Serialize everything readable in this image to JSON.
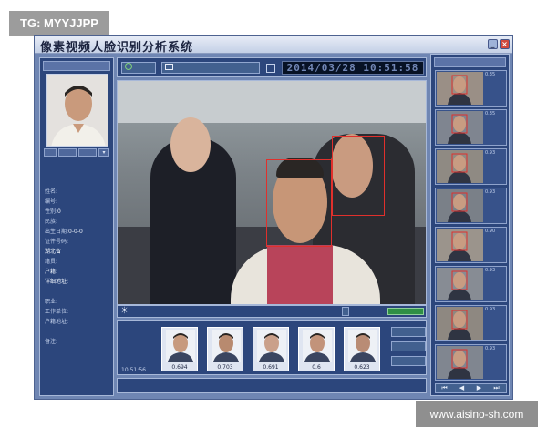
{
  "badges": {
    "top": "TG: MYYJJPP",
    "bottom": "www.aisino-sh.com"
  },
  "window": {
    "title": "像素视频人脸识别分析系统"
  },
  "left_panel": {
    "header": "",
    "buttons": [
      "",
      "",
      ""
    ],
    "fields": [
      {
        "key": "姓名:",
        "value": ""
      },
      {
        "key": "编号:",
        "value": ""
      },
      {
        "key": "性别:",
        "value": "0"
      },
      {
        "key": "民族:",
        "value": ""
      },
      {
        "key": "出生日期:",
        "value": "0-0-0"
      },
      {
        "key": "证件号码:",
        "value": ""
      },
      {
        "key": "",
        "value": "湖北省"
      },
      {
        "key": "籍贯:",
        "value": ""
      },
      {
        "key": "",
        "value": "户籍:"
      },
      {
        "key": "",
        "value": "详细地址:"
      },
      {
        "key": "",
        "value": ""
      },
      {
        "key": "职业:",
        "value": ""
      },
      {
        "key": "工作单位:",
        "value": ""
      },
      {
        "key": "户籍地址:",
        "value": ""
      },
      {
        "key": "",
        "value": ""
      },
      {
        "key": "备注:",
        "value": ""
      }
    ],
    "footer_lines": [
      "",
      "",
      ""
    ]
  },
  "toolbar": {
    "button_1": "",
    "button_2": "",
    "small_button": "",
    "clock": "2014/03/28 10:51:58"
  },
  "status_strip": {
    "items": [
      "",
      "",
      ""
    ],
    "button": ""
  },
  "bottom_strip": {
    "time": "10:51:56",
    "scores": [
      "0.694",
      "0.703",
      "0.691",
      "0.6",
      "0.623"
    ],
    "buttons": [
      "",
      "",
      ""
    ]
  },
  "footer": {
    "left": "",
    "right": ""
  },
  "right_panel": {
    "header": "",
    "rows": [
      {
        "time": "",
        "score": "0.35"
      },
      {
        "time": "",
        "score": "0.35"
      },
      {
        "time": "",
        "score": "0.93"
      },
      {
        "time": "",
        "score": "0.93"
      },
      {
        "time": "",
        "score": "0.90"
      },
      {
        "time": "",
        "score": "0.93"
      },
      {
        "time": "",
        "score": "0.93"
      },
      {
        "time": "",
        "score": "0.93"
      }
    ]
  },
  "colors": {
    "window_frame": "#6f86b3",
    "panel": "#2c467c",
    "panel_border": "#a7b8d8",
    "detection_box": "#e0302c",
    "clock_bg": "#071225",
    "clock_text": "#7287b6"
  },
  "icons": [
    "clock-icon",
    "camera-icon",
    "sun-icon",
    "minimize-icon",
    "close-icon"
  ]
}
